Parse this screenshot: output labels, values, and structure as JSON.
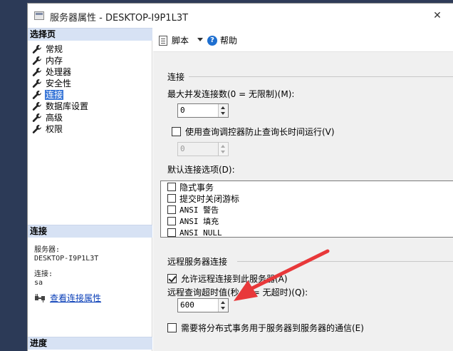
{
  "window": {
    "title": "服务器属性 - DESKTOP-I9P1L3T",
    "close_glyph": "✕"
  },
  "left": {
    "select_page_header": "选择页",
    "nav_items": [
      {
        "label": "常规",
        "selected": false
      },
      {
        "label": "内存",
        "selected": false
      },
      {
        "label": "处理器",
        "selected": false
      },
      {
        "label": "安全性",
        "selected": false
      },
      {
        "label": "连接",
        "selected": true
      },
      {
        "label": "数据库设置",
        "selected": false
      },
      {
        "label": "高级",
        "selected": false
      },
      {
        "label": "权限",
        "selected": false
      }
    ],
    "connection_header": "连接",
    "server_label": "服务器:",
    "server_value": "DESKTOP-I9P1L3T",
    "conn_label": "连接:",
    "conn_value": "sa",
    "view_props_link": "查看连接属性",
    "progress_header": "进度"
  },
  "toolbar": {
    "script_label": "脚本",
    "help_label": "帮助"
  },
  "connections": {
    "group_title": "连接",
    "max_conn_label": "最大并发连接数(0 = 无限制)(M):",
    "max_conn_value": "0",
    "query_governor_label": "使用查询调控器防止查询长时间运行(V)",
    "query_governor_checked": false,
    "query_governor_value": "0",
    "default_options_label": "默认连接选项(D):",
    "default_options": [
      {
        "label": "隐式事务",
        "checked": false,
        "mono": false
      },
      {
        "label": "提交时关闭游标",
        "checked": false,
        "mono": false
      },
      {
        "label": "ANSI 警告",
        "checked": false,
        "mono": true
      },
      {
        "label": "ANSI 填充",
        "checked": false,
        "mono": true
      },
      {
        "label": "ANSI NULL",
        "checked": false,
        "mono": true
      }
    ]
  },
  "remote": {
    "group_title": "远程服务器连接",
    "allow_remote_label": "允许远程连接到此服务器(A)",
    "allow_remote_checked": true,
    "timeout_label": "远程查询超时值(秒, 0 = 无超时)(Q):",
    "timeout_value": "600",
    "distributed_label": "需要将分布式事务用于服务器到服务器的通信(E)",
    "distributed_checked": false
  },
  "annotation": {
    "arrow_color": "#e8383a"
  }
}
